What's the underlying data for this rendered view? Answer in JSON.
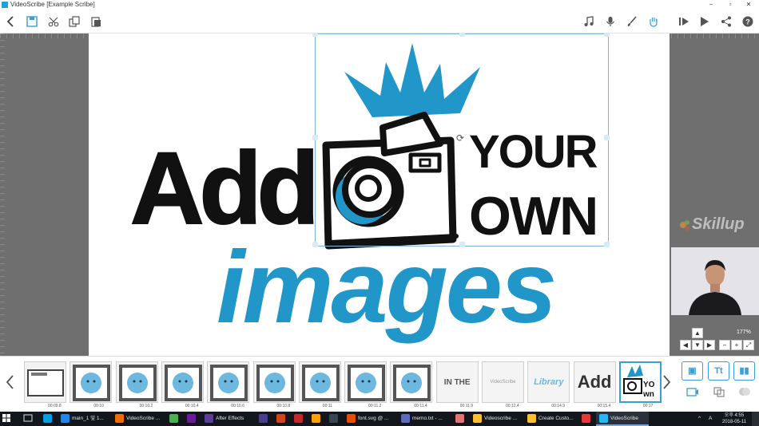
{
  "window": {
    "title": "VideoScribe [Example Scribe]",
    "controls": [
      "−",
      "▫",
      "✕"
    ]
  },
  "toolbar": {
    "left_icons": [
      "back-icon",
      "save-icon",
      "cut-icon",
      "copy-icon",
      "paste-icon"
    ],
    "right_icons": [
      "music-icon",
      "microphone-icon",
      "brush-icon",
      "hand-icon",
      "preview-icon",
      "play-icon",
      "share-icon",
      "help-icon"
    ]
  },
  "canvas": {
    "heading_word_1": "Add",
    "heading_word_2": "YOUR",
    "heading_word_3": "OWN",
    "subtitle": "images",
    "ink_color": "#111111",
    "accent_color": "#2196c9"
  },
  "watermark": {
    "brand": "Skillup"
  },
  "zoom": {
    "percent": "177%"
  },
  "timeline": {
    "thumbnails": [
      {
        "kind": "window",
        "time": "00:09.8"
      },
      {
        "kind": "face",
        "time": "00:10"
      },
      {
        "kind": "face",
        "time": "00:10.2"
      },
      {
        "kind": "face",
        "time": "00:10.4"
      },
      {
        "kind": "face",
        "time": "00:10.6"
      },
      {
        "kind": "face",
        "time": "00:10.8"
      },
      {
        "kind": "face",
        "time": "00:11"
      },
      {
        "kind": "face",
        "time": "00:11.2"
      },
      {
        "kind": "face",
        "time": "00:11.4"
      },
      {
        "kind": "text",
        "text": "IN THE",
        "time": "00:11.9"
      },
      {
        "kind": "text-small",
        "text": "VideoScribe",
        "time": "00:12.4"
      },
      {
        "kind": "text-blue",
        "text": "Library",
        "time": "00:14.9"
      },
      {
        "kind": "text-big",
        "text": "Add",
        "time": "00:15.4"
      },
      {
        "kind": "camera",
        "text": "YOUR OWN",
        "time": "00:17"
      }
    ],
    "side_buttons": [
      {
        "name": "add-image-button",
        "label": "▣"
      },
      {
        "name": "add-text-button",
        "label": "Tt"
      },
      {
        "name": "add-chart-button",
        "label": "▮▮"
      }
    ]
  },
  "taskbar": {
    "items": [
      {
        "label": "",
        "color": "#00a1e4",
        "icon": "ps-icon"
      },
      {
        "label": "main_1 및 1...",
        "color": "#1e88e5",
        "icon": "edge-icon"
      },
      {
        "label": "VideoScribe ...",
        "color": "#ef6c00",
        "icon": "firefox-icon"
      },
      {
        "label": "",
        "color": "#4caf50",
        "icon": "chrome-icon"
      },
      {
        "label": "",
        "color": "#6a1b9a",
        "icon": "pr-icon"
      },
      {
        "label": "After Effects",
        "color": "#5c3d99",
        "icon": "ae-icon"
      },
      {
        "label": "",
        "color": "#4a3d8f",
        "icon": "ae2-icon"
      },
      {
        "label": "",
        "color": "#d84315",
        "icon": "ppt-icon"
      },
      {
        "label": "",
        "color": "#c62828",
        "icon": "crop-icon"
      },
      {
        "label": "",
        "color": "#ffa000",
        "icon": "folder-icon"
      },
      {
        "label": "",
        "color": "#37474f",
        "icon": "app-icon"
      },
      {
        "label": "font.svg @ ...",
        "color": "#e65100",
        "icon": "ai-icon"
      },
      {
        "label": "memo.txt - ...",
        "color": "#5c6bc0",
        "icon": "notepad-icon"
      },
      {
        "label": "",
        "color": "#e57373",
        "icon": "app2-icon"
      },
      {
        "label": "Videoscribe ...",
        "color": "#fbc02d",
        "icon": "folder2-icon"
      },
      {
        "label": "Create Custo...",
        "color": "#fbc02d",
        "icon": "folder3-icon"
      },
      {
        "label": "",
        "color": "#e53935",
        "icon": "filezilla-icon"
      },
      {
        "label": "VideoScribe",
        "color": "#29b6f6",
        "icon": "videoscribe-icon"
      }
    ],
    "clock_time": "오후 4:55",
    "clock_date": "2018-05-11",
    "ime": "A"
  }
}
